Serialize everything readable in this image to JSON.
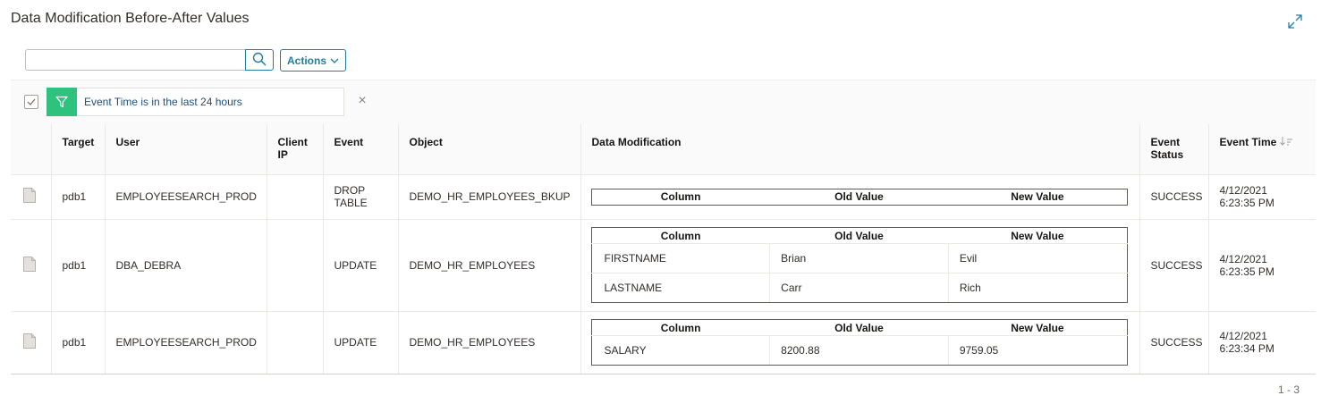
{
  "page": {
    "title": "Data Modification Before-After Values",
    "expand_icon": "expand-icon"
  },
  "toolbar": {
    "search_value": "",
    "search_placeholder": "",
    "search_icon": "search-icon",
    "actions_label": "Actions",
    "actions_icon": "chevron-down-icon"
  },
  "filter": {
    "checked": true,
    "icon": "funnel-icon",
    "label": "Event Time is in the last 24 hours",
    "clear_icon": "close-icon"
  },
  "table": {
    "columns": [
      "",
      "Target",
      "User",
      "Client IP",
      "Event",
      "Object",
      "Data Modification",
      "Event Status",
      "Event Time"
    ],
    "sort": {
      "column": "Event Time",
      "direction": "descending"
    },
    "mod_headers": [
      "Column",
      "Old Value",
      "New Value"
    ],
    "rows": [
      {
        "icon": "document-icon",
        "target": "pdb1",
        "user": "EMPLOYEESEARCH_PROD",
        "client_ip": "",
        "event": "DROP TABLE",
        "object": "DEMO_HR_EMPLOYEES_BKUP",
        "modifications": [],
        "status": "SUCCESS",
        "event_time": "4/12/2021 6:23:35 PM"
      },
      {
        "icon": "document-icon",
        "target": "pdb1",
        "user": "DBA_DEBRA",
        "client_ip": "",
        "event": "UPDATE",
        "object": "DEMO_HR_EMPLOYEES",
        "modifications": [
          {
            "column": "FIRSTNAME",
            "old": "Brian",
            "new": "Evil"
          },
          {
            "column": "LASTNAME",
            "old": "Carr",
            "new": "Rich"
          }
        ],
        "status": "SUCCESS",
        "event_time": "4/12/2021 6:23:35 PM"
      },
      {
        "icon": "document-icon",
        "target": "pdb1",
        "user": "EMPLOYEESEARCH_PROD",
        "client_ip": "",
        "event": "UPDATE",
        "object": "DEMO_HR_EMPLOYEES",
        "modifications": [
          {
            "column": "SALARY",
            "old": "8200.88",
            "new": "9759.05"
          }
        ],
        "status": "SUCCESS",
        "event_time": "4/12/2021 6:23:34 PM"
      }
    ]
  },
  "pagination": {
    "label": "1 - 3"
  },
  "colors": {
    "accent": "#227e9e",
    "filter_green": "#2ec27e",
    "filter_text": "#1f4e79"
  }
}
